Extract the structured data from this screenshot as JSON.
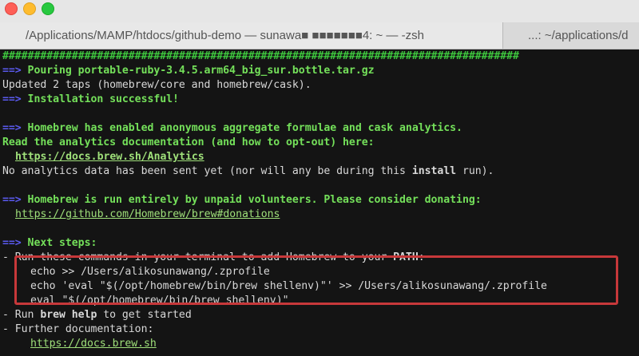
{
  "window": {
    "tabs": [
      {
        "label": "/Applications/MAMP/htdocs/github-demo — sunawa■ ■■■■■■■4: ~ — -zsh"
      },
      {
        "label": "...: ~/applications/d"
      }
    ]
  },
  "terminal": {
    "hash_line": "##################################################################################",
    "lines": [
      {
        "arrow": "==>",
        "text": " Pouring portable-ruby-3.4.5.arm64_big_sur.bottle.tar.gz"
      },
      {
        "text": "Updated 2 taps (homebrew/core and homebrew/cask)."
      },
      {
        "arrow": "==>",
        "text": " Installation successful!"
      },
      {
        "arrow": "==>",
        "text": " Homebrew has enabled anonymous aggregate formulae and cask analytics."
      },
      {
        "text": "Read the analytics documentation (and how to opt-out) here:"
      },
      {
        "link": "https://docs.brew.sh/Analytics"
      },
      {
        "text_a": "No analytics data has been sent yet (nor will any be during this ",
        "bold": "install",
        "text_b": " run)."
      },
      {
        "arrow": "==>",
        "text": " Homebrew is run entirely by unpaid volunteers. Please consider donating:"
      },
      {
        "link": "https://github.com/Homebrew/brew#donations"
      },
      {
        "arrow": "==>",
        "text": " Next steps:"
      },
      {
        "text_a": "- Run these commands in your terminal to add Homebrew to your ",
        "bold": "PATH",
        "text_b": ":"
      },
      {
        "text": "echo >> /Users/alikosunawang/.zprofile"
      },
      {
        "text": "echo 'eval \"$(/opt/homebrew/bin/brew shellenv)\"' >> /Users/alikosunawang/.zprofile"
      },
      {
        "text": "eval \"$(/opt/homebrew/bin/brew shellenv)\""
      },
      {
        "text_a": "- Run ",
        "bold": "brew help",
        "text_b": " to get started"
      },
      {
        "text": "- Further documentation:"
      },
      {
        "link": "https://docs.brew.sh"
      }
    ]
  },
  "colors": {
    "hash": "#3ec83e",
    "arrow": "#5a5af0",
    "heading": "#74e05a",
    "highlight": "#c7383a"
  }
}
